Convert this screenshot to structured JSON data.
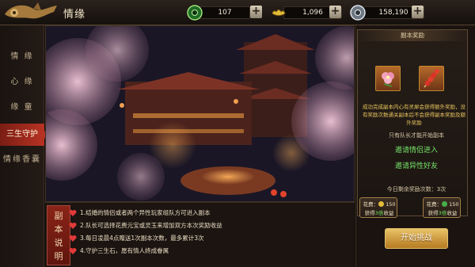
{
  "header": {
    "title": "情缘",
    "resources": [
      {
        "name": "jade",
        "value": "107",
        "color": "#44b04a"
      },
      {
        "name": "gold",
        "value": "1,096",
        "color": "#e2bd3a"
      },
      {
        "name": "silver",
        "value": "158,190",
        "color": "#b9c3ce"
      }
    ],
    "add_label": "+"
  },
  "sidebar": {
    "items": [
      {
        "label": "情 缘",
        "active": false
      },
      {
        "label": "心 缘",
        "active": false
      },
      {
        "label": "缘 童",
        "active": false
      },
      {
        "label": "三生守护",
        "active": true
      },
      {
        "label": "情缘香囊",
        "active": false
      }
    ]
  },
  "rules": {
    "badge": [
      "副",
      "本",
      "说",
      "明"
    ],
    "lines": [
      "1.结婚的情侣或者两个异性玩家组队方可进入副本",
      "2.队长可选择花费元宝或灵玉来增加双方本次奖励收益",
      "3.每日凌晨4点赠送1次副本次数，最多累计3次",
      "4.守护三生石，愿有情人终成眷属"
    ]
  },
  "panel": {
    "reward_title": "副本奖励",
    "reward_items": [
      "flower-icon",
      "candied-haws-icon"
    ],
    "reward_desc": "成功完成副本内心有灵犀会获得额外奖励，没有奖励次数通关副本后不会获得副本奖励及额外奖励",
    "only_leader": "只有队长才能开始副本",
    "invite_partner": "邀请情侣进入",
    "invite_opposite": "邀请异性好友",
    "remaining": "今日剩余奖励次数：3次",
    "costs": [
      {
        "label": "花费：",
        "amount": "150",
        "gain_prefix": "获得",
        "gain": "3倍",
        "gain_suffix": "收益",
        "currency_color": "#e2bd3a"
      },
      {
        "label": "花费：",
        "amount": "150",
        "gain_prefix": "获得",
        "gain": "3倍",
        "gain_suffix": "收益",
        "currency_color": "#44b04a"
      }
    ],
    "start_button": "开始挑战"
  }
}
